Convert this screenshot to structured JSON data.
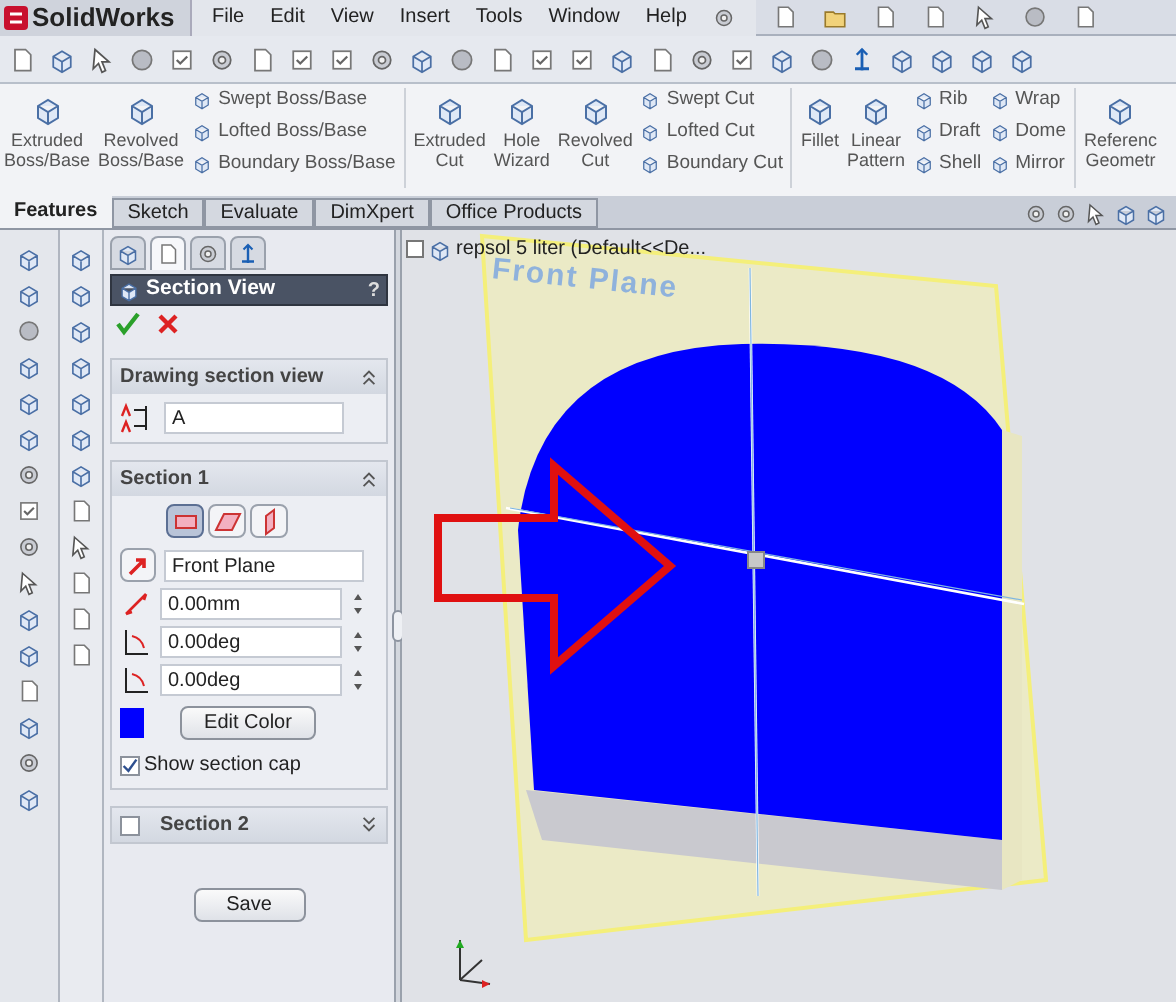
{
  "app": {
    "name": "SolidWorks"
  },
  "menu": [
    "File",
    "Edit",
    "View",
    "Insert",
    "Tools",
    "Window",
    "Help"
  ],
  "ribbon": [
    {
      "kind": "big",
      "lines": [
        "Extruded",
        "Boss/Base"
      ]
    },
    {
      "kind": "big",
      "lines": [
        "Revolved",
        "Boss/Base"
      ]
    },
    {
      "kind": "stack",
      "items": [
        "Swept Boss/Base",
        "Lofted Boss/Base",
        "Boundary Boss/Base"
      ]
    },
    {
      "kind": "big",
      "lines": [
        "Extruded",
        "Cut"
      ]
    },
    {
      "kind": "big",
      "lines": [
        "Hole",
        "Wizard"
      ]
    },
    {
      "kind": "big",
      "lines": [
        "Revolved",
        "Cut"
      ]
    },
    {
      "kind": "stack",
      "items": [
        "Swept Cut",
        "Lofted Cut",
        "Boundary Cut"
      ]
    },
    {
      "kind": "big",
      "lines": [
        "Fillet"
      ]
    },
    {
      "kind": "big",
      "lines": [
        "Linear",
        "Pattern"
      ]
    },
    {
      "kind": "stack",
      "items": [
        "Rib",
        "Draft",
        "Shell"
      ]
    },
    {
      "kind": "stack",
      "items": [
        "Wrap",
        "Dome",
        "Mirror"
      ]
    },
    {
      "kind": "big",
      "lines": [
        "Referenc",
        "Geometr"
      ]
    }
  ],
  "tabs": [
    {
      "label": "Features",
      "selected": true
    },
    {
      "label": "Sketch",
      "selected": false
    },
    {
      "label": "Evaluate",
      "selected": false
    },
    {
      "label": "DimXpert",
      "selected": false
    },
    {
      "label": "Office Products",
      "selected": false
    }
  ],
  "property_manager": {
    "tabs": [
      {
        "selected": false
      },
      {
        "selected": true
      },
      {
        "selected": false
      },
      {
        "selected": false
      }
    ],
    "title": "Section View",
    "help": "?",
    "groups": [
      {
        "title": "Drawing section view",
        "expanded": true,
        "kind": "name",
        "value": "A"
      },
      {
        "title": "Section 1",
        "expanded": true,
        "kind": "section",
        "planes": [
          {
            "selected": true
          },
          {
            "selected": false
          },
          {
            "selected": false
          }
        ],
        "reference": "Front Plane",
        "distance": "0.00mm",
        "angle_x": "0.00deg",
        "angle_y": "0.00deg",
        "color": "#0000ff",
        "color_button": "Edit Color",
        "cap": {
          "label": "Show section cap",
          "checked": true
        }
      },
      {
        "title": "Section 2",
        "expanded": false,
        "kind": "toggle",
        "checked": false
      }
    ],
    "save": "Save"
  },
  "viewport": {
    "tree_item": "repsol 5 liter  (Default<<De...",
    "plane_label": "Front Plane"
  }
}
